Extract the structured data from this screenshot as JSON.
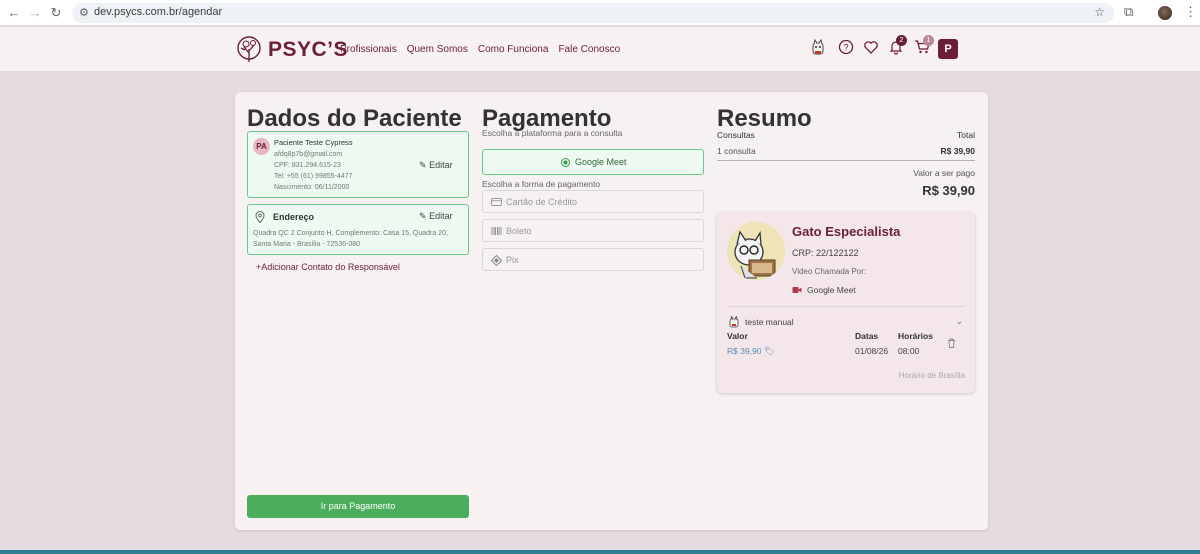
{
  "browser": {
    "url": "dev.psycs.com.br/agendar"
  },
  "site": {
    "logo_text": "PSYC’S",
    "nav": [
      "Profissionais",
      "Quem Somos",
      "Como Funciona",
      "Fale Conosco"
    ],
    "notifications_count": "2",
    "cart_count": "1",
    "user_initial": "P"
  },
  "patient": {
    "heading": "Dados do Paciente",
    "initials": "PA",
    "name": "Paciente Teste Cypress",
    "email": "afdq8p7b@gmail.com",
    "cpf": "CPF: 831.294.615-23",
    "phone": "Tel: +55 (61) 99855-4477",
    "birth": "Nascimento: 06/11/2000",
    "edit_label": "Editar",
    "address_heading": "Endereço",
    "address_line1": "Quadra QC 2 Conjunto H, Complemento: Casa 15, Quadra 20,",
    "address_line2": "Santa Maria - Brasília - 72536-080",
    "add_contact": "Adicionar Contato do Responsável",
    "submit": "Ir para Pagamento"
  },
  "payment": {
    "heading": "Pagamento",
    "platform_label": "Escolha a plataforma para a consulta",
    "platform_selected": "Google Meet",
    "method_label": "Escolha a forma de pagamento",
    "methods": [
      "Cartão de Crédito",
      "Boleto",
      "Pix"
    ]
  },
  "summary": {
    "heading": "Resumo",
    "col_left": "Consultas",
    "col_right": "Total",
    "count": "1 consulta",
    "total": "R$ 39,90",
    "to_pay_label": "Valor a ser pago",
    "to_pay": "R$ 39,90"
  },
  "professional": {
    "name": "Gato Especialista",
    "crp": "CRP: 22/122122",
    "video_label": "Video Chamada Por:",
    "platform": "Google Meet",
    "patient_name": "teste manual",
    "valor_label": "Valor",
    "valor": "R$ 39,90",
    "datas_label": "Datas",
    "data": "01/08/26",
    "horarios_label": "Horários",
    "horario": "08:00",
    "timezone": "Horário de Brasília"
  },
  "colors": {
    "brand": "#6b1f36",
    "success": "#4cae5c",
    "selected_border": "#67c784"
  }
}
